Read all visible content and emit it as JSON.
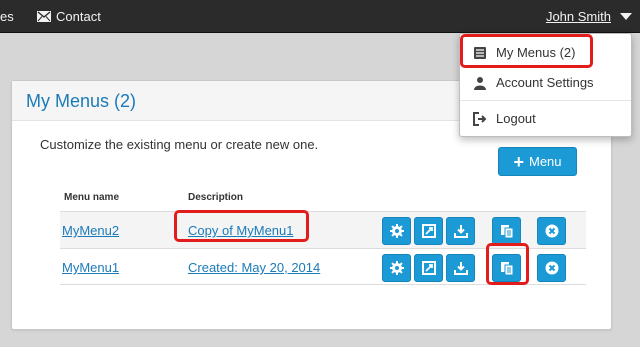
{
  "navbar": {
    "prev_item_fragment": "es",
    "contact_label": "Contact",
    "user_name": "John Smith"
  },
  "dropdown": {
    "items": [
      {
        "label": "My Menus (2)",
        "icon": "menu-book-icon"
      },
      {
        "label": "Account Settings",
        "icon": "user-icon"
      },
      {
        "label": "Logout",
        "icon": "logout-icon"
      }
    ]
  },
  "panel": {
    "title": "My Menus (2)",
    "description": "Customize the existing menu or create new one.",
    "add_button_label": "Menu",
    "table": {
      "headers": {
        "name": "Menu name",
        "description": "Description"
      },
      "rows": [
        {
          "name": "MyMenu2",
          "description": "Copy of MyMenu1"
        },
        {
          "name": "MyMenu1",
          "description": "Created: May 20, 2014"
        }
      ],
      "actions": [
        "gear-icon",
        "edit-icon",
        "download-icon",
        "copy-icon",
        "delete-icon"
      ]
    }
  },
  "colors": {
    "accent": "#1b9ad6",
    "link": "#1a7bb9",
    "navbar": "#2b2b2b",
    "highlight": "#e21b1b"
  }
}
